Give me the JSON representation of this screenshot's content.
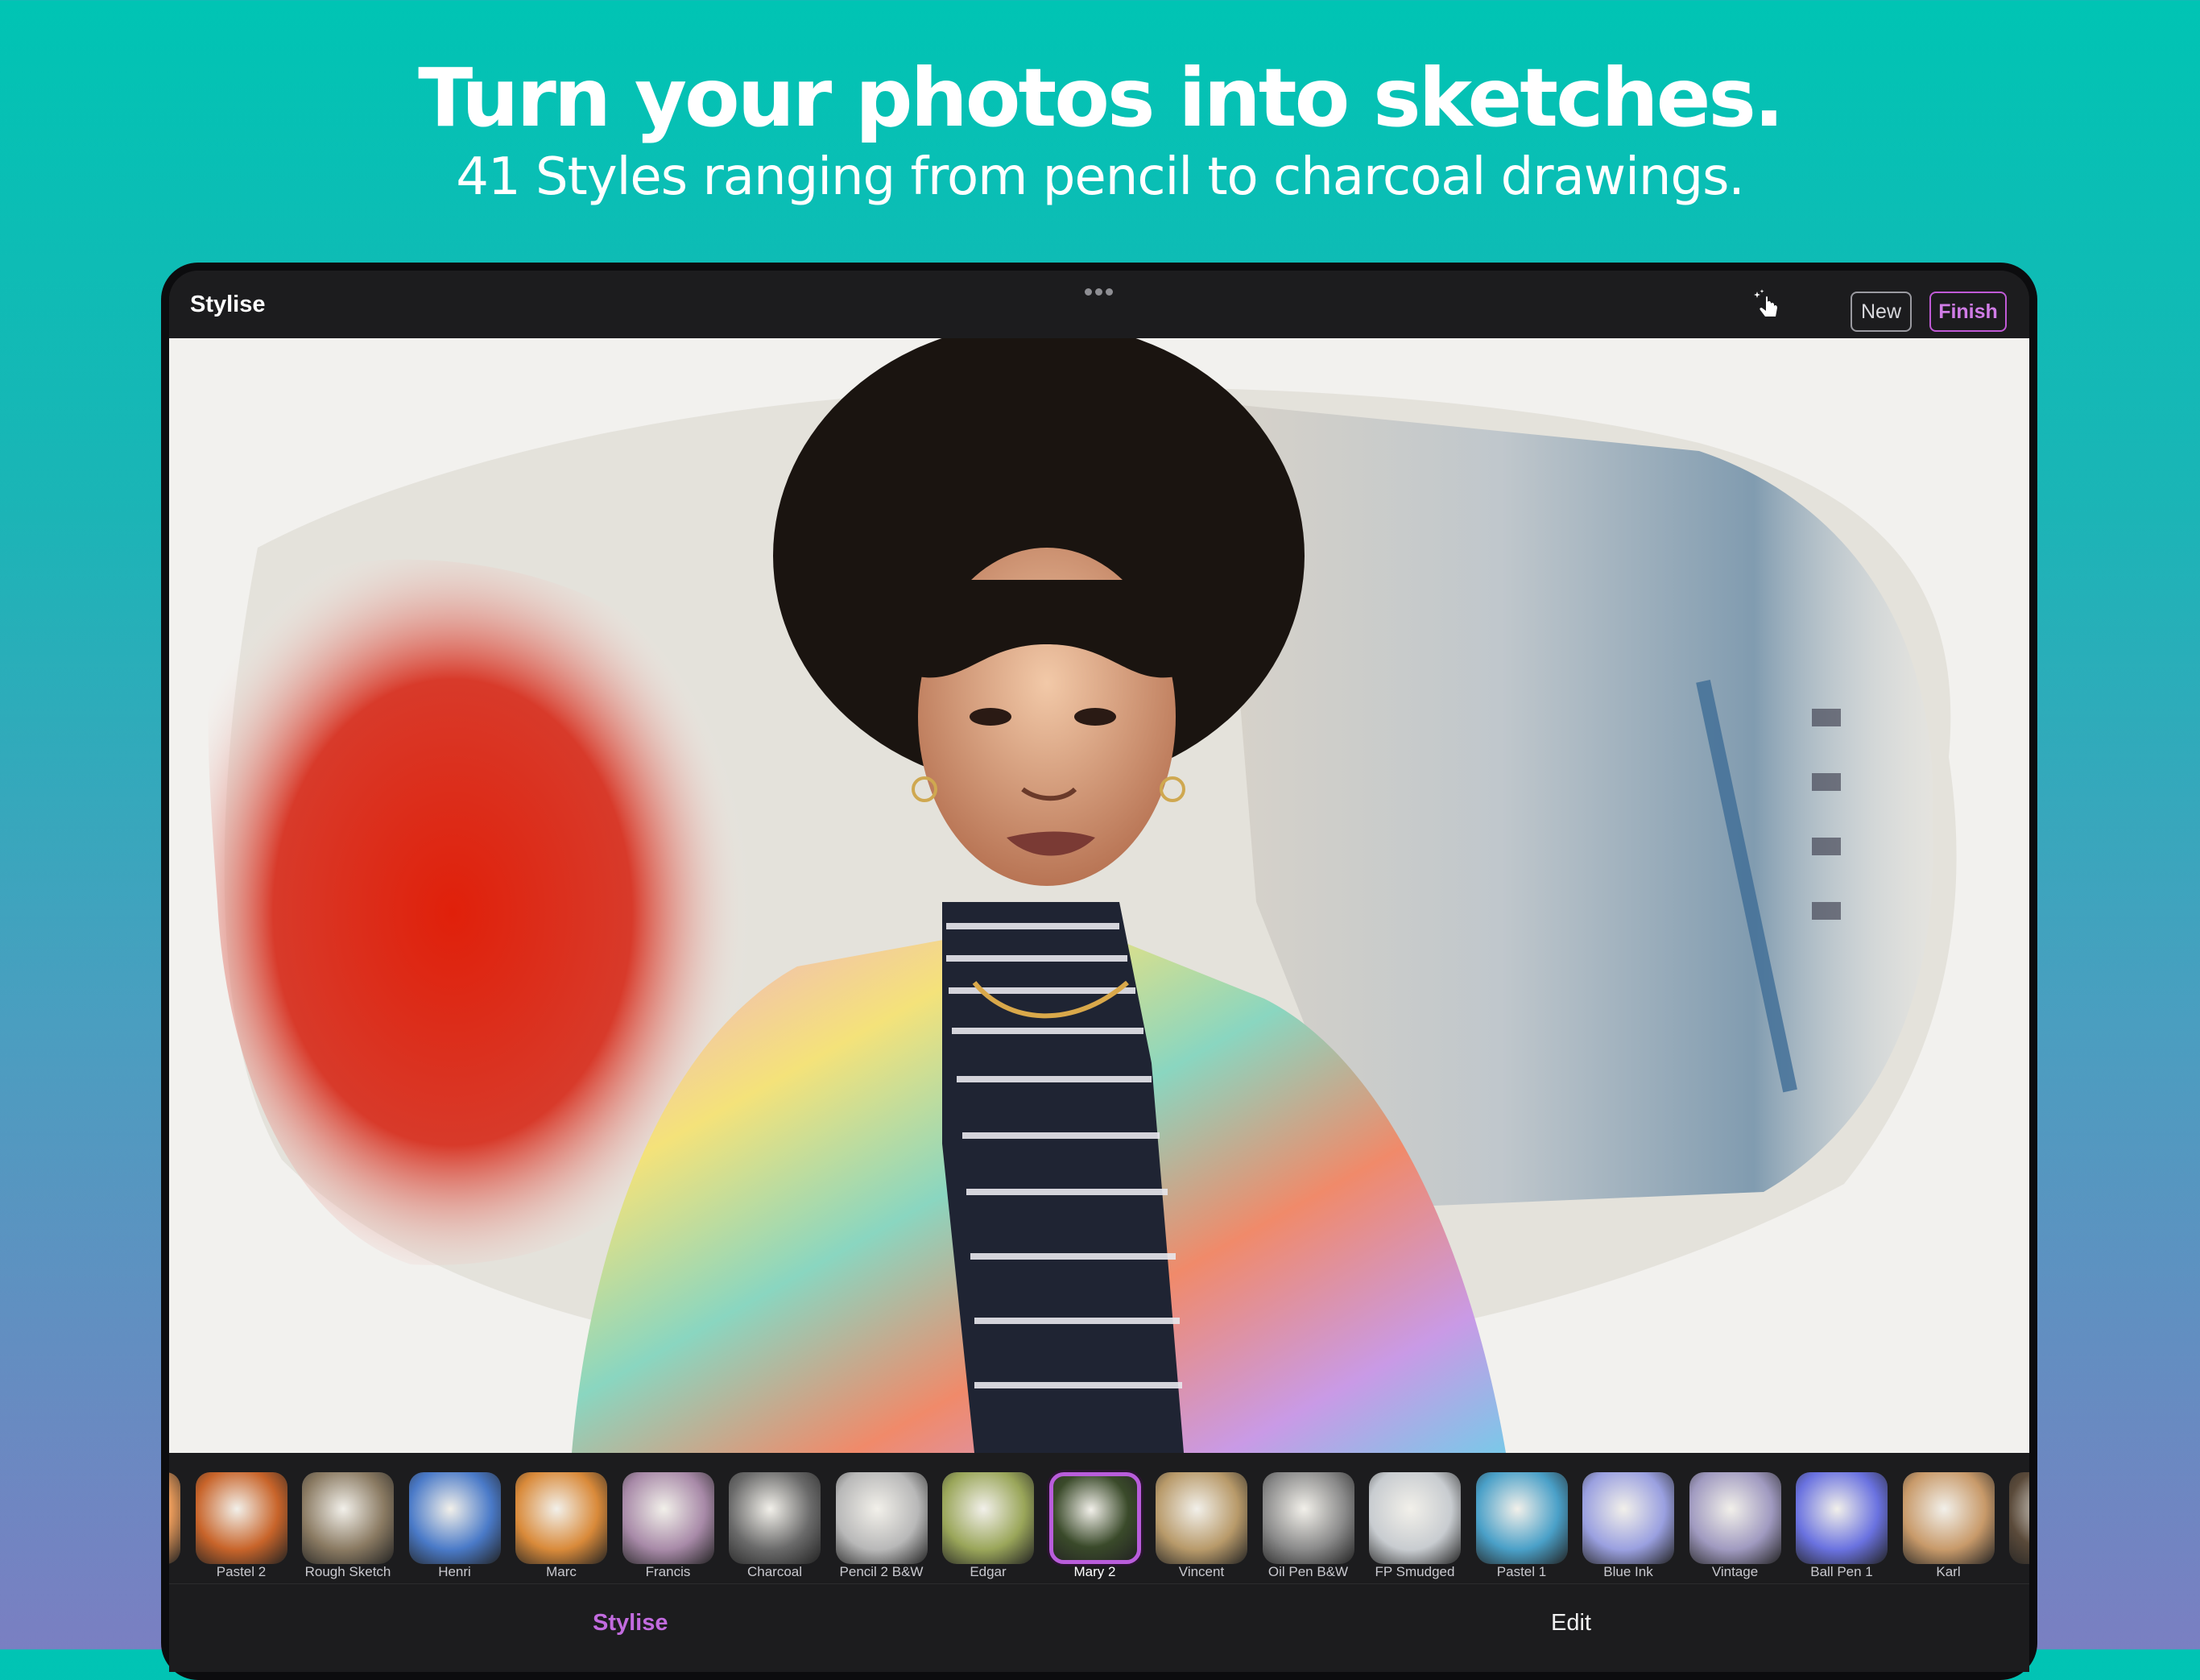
{
  "banner": {
    "headline": "Turn your photos into sketches.",
    "subheadline": "41 Styles ranging from pencil to charcoal drawings."
  },
  "toolbar": {
    "title": "Stylise",
    "tap_icon": "tap-sparkle-icon",
    "new_label": "New",
    "finish_label": "Finish"
  },
  "styles": [
    {
      "label": "",
      "color": "#e89a5a"
    },
    {
      "label": "Pastel 2",
      "color": "#c8642a"
    },
    {
      "label": "Rough Sketch",
      "color": "#8a7a62"
    },
    {
      "label": "Henri",
      "color": "#4a7ac8"
    },
    {
      "label": "Marc",
      "color": "#d98a3a"
    },
    {
      "label": "Francis",
      "color": "#a88aa8"
    },
    {
      "label": "Charcoal",
      "color": "#6a6a6a"
    },
    {
      "label": "Pencil 2 B&W",
      "color": "#b8b8b8"
    },
    {
      "label": "Edgar",
      "color": "#9aa65a"
    },
    {
      "label": "Mary 2",
      "color": "#3a4a2a",
      "selected": true
    },
    {
      "label": "Vincent",
      "color": "#b89a6a"
    },
    {
      "label": "Oil Pen B&W",
      "color": "#8a8a8a"
    },
    {
      "label": "FP Smudged",
      "color": "#c8ccd0"
    },
    {
      "label": "Pastel 1",
      "color": "#4aa0c8"
    },
    {
      "label": "Blue Ink",
      "color": "#9aa0e0"
    },
    {
      "label": "Vintage",
      "color": "#a09ac0"
    },
    {
      "label": "Ball Pen 1",
      "color": "#6a72e0"
    },
    {
      "label": "Karl",
      "color": "#c89a6a"
    },
    {
      "label": "",
      "color": "#5a4a3a"
    }
  ],
  "tabs": {
    "stylise": "Stylise",
    "edit": "Edit"
  },
  "colors": {
    "accent": "#c05ad6",
    "bar": "#1c1c1e"
  }
}
